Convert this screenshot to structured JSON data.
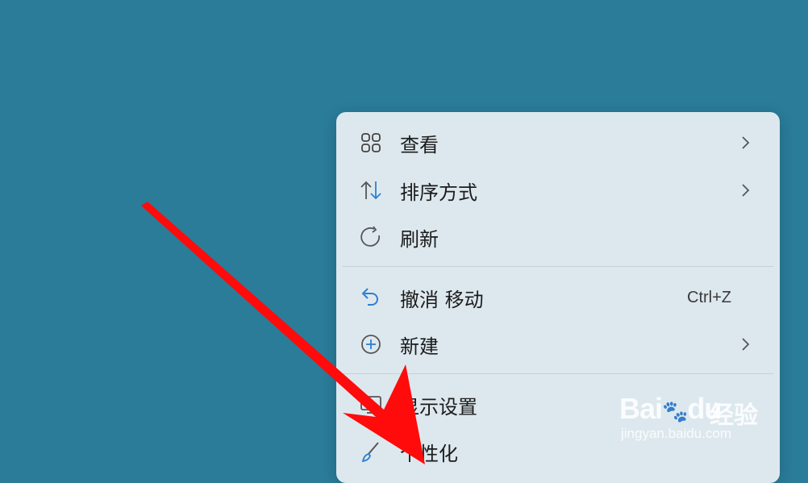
{
  "menu": {
    "items": [
      {
        "label": "查看",
        "icon": "grid-view-icon",
        "submenu": true
      },
      {
        "label": "排序方式",
        "icon": "sort-arrows-icon",
        "submenu": true
      },
      {
        "label": "刷新",
        "icon": "refresh-icon",
        "submenu": false
      },
      {
        "label": "撤消 移动",
        "icon": "undo-icon",
        "shortcut": "Ctrl+Z",
        "submenu": false
      },
      {
        "label": "新建",
        "icon": "new-plus-icon",
        "submenu": true
      },
      {
        "label": "显示设置",
        "icon": "display-icon",
        "submenu": false
      },
      {
        "label": "个性化",
        "icon": "brush-icon",
        "submenu": false
      }
    ]
  },
  "watermark": {
    "brand": "Bai",
    "brand_du": "du",
    "brand_cn": "经验",
    "url": "jingyan.baidu.com"
  },
  "colors": {
    "desktop": "#2a7c99",
    "menu_bg": "#dde8ee",
    "accent_blue": "#2f7fd0",
    "arrow_red": "#ff0b0b"
  }
}
